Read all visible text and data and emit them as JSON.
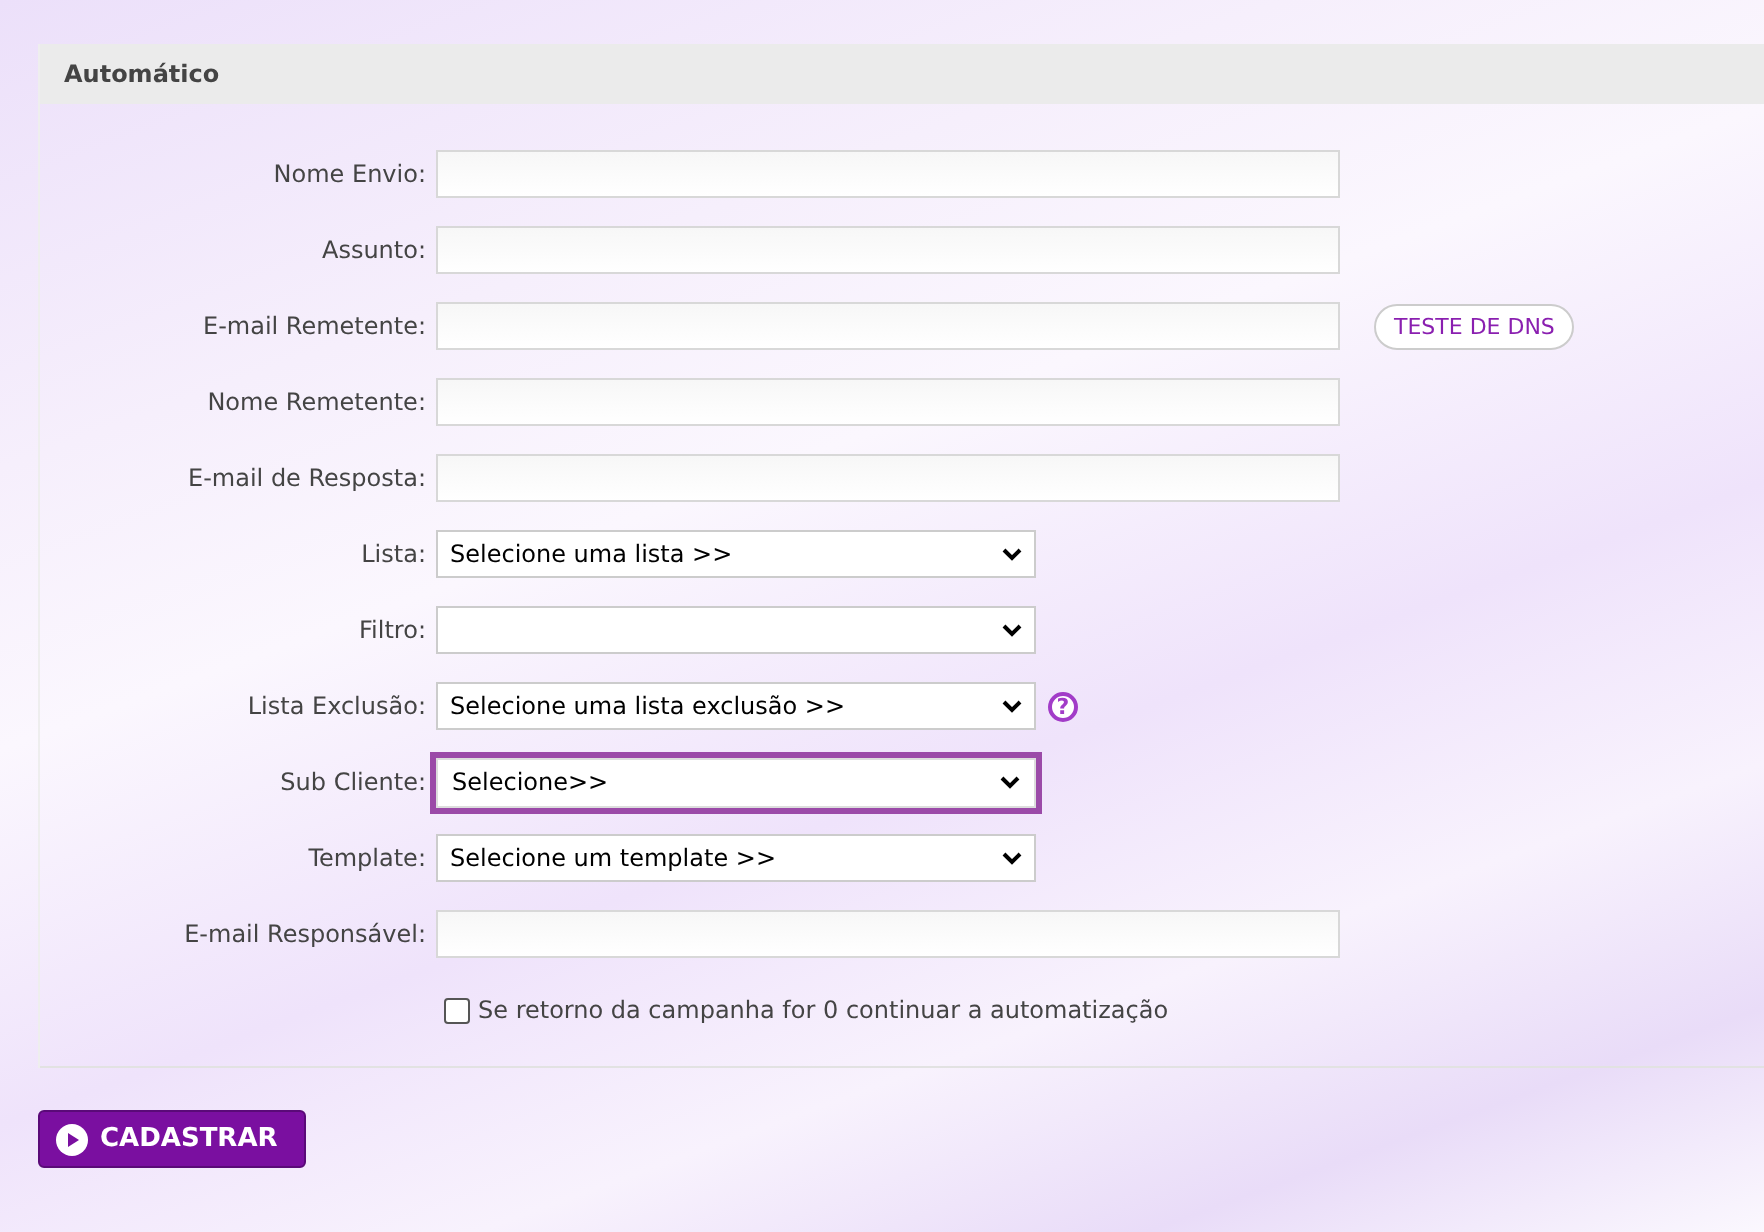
{
  "panel": {
    "title": "Automático"
  },
  "fields": [
    {
      "label": "Nome Envio:",
      "kind": "text"
    },
    {
      "label": "Assunto:",
      "kind": "text"
    },
    {
      "label": "E-mail Remetente:",
      "kind": "text",
      "action": "TESTE DE DNS"
    },
    {
      "label": "Nome Remetente:",
      "kind": "text"
    },
    {
      "label": "E-mail de Resposta:",
      "kind": "text"
    },
    {
      "label": "Lista:",
      "kind": "select",
      "value": "Selecione uma lista >>",
      "focused": false
    },
    {
      "label": "Filtro:",
      "kind": "select",
      "focused": false
    },
    {
      "label": "Lista Exclusão:",
      "kind": "select",
      "value": "Selecione uma lista exclusão >>",
      "focused": false,
      "help": "?"
    },
    {
      "label": "Sub Cliente:",
      "kind": "select",
      "value": "Selecione>>",
      "focused": true
    },
    {
      "label": "Template:",
      "kind": "select",
      "value": "Selecione um template >>",
      "focused": false
    },
    {
      "label": "E-mail Responsável:",
      "kind": "text"
    }
  ],
  "option": {
    "label": "Se retorno da campanha for 0 continuar a automatização",
    "checked": false
  },
  "submit": {
    "label": "CADASTRAR"
  }
}
